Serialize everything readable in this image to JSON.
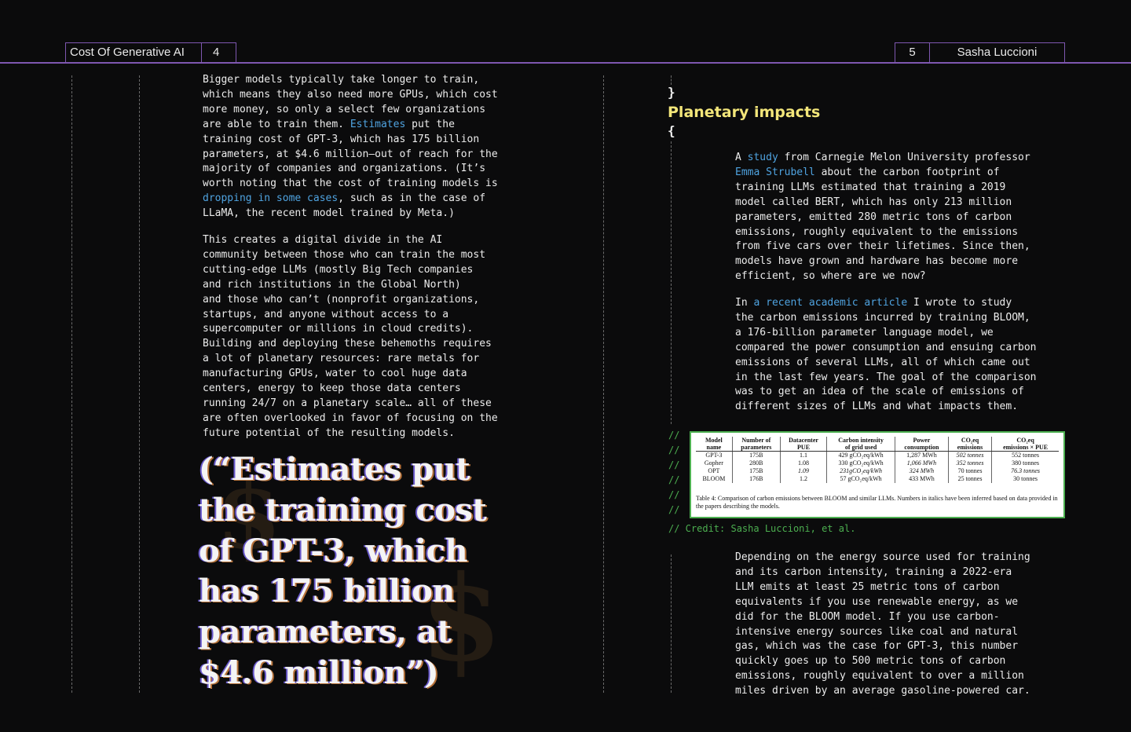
{
  "header": {
    "left_title": "Cost Of Generative AI",
    "left_page": "4",
    "right_page": "5",
    "right_author": "Sasha Luccioni"
  },
  "left": {
    "p1": [
      {
        "t": "Bigger models typically take longer to train,\nwhich means they also need more GPUs, which cost\nmore money, so only a select few organizations\nare able to train them. "
      },
      {
        "t": "Estimates",
        "link": true
      },
      {
        "t": " put the\ntraining cost of GPT-3, which has 175 billion\nparameters, at $4.6 million—out of reach for the\nmajority of companies and organizations. (It’s\nworth noting that the cost of training models is\n"
      },
      {
        "t": "dropping in some cases",
        "link": true
      },
      {
        "t": ", such as in the case of\nLLaMA, the recent model trained by Meta.)"
      }
    ],
    "p2": "This creates a digital divide in the AI\ncommunity between those who can train the most\ncutting-edge LLMs (mostly Big Tech companies\nand rich institutions in the Global North)\nand those who can’t (nonprofit organizations,\nstartups, and anyone without access to a\nsupercomputer or millions in cloud credits).\nBuilding and deploying these behemoths requires\na lot of planetary resources: rare metals for\nmanufacturing GPUs, water to cool huge data\ncenters, energy to keep those data centers\nrunning 24/7 on a planetary scale… all of these\nare often overlooked in favor of focusing on the\nfuture potential of the resulting models.",
    "quote": "(“Estimates put\nthe training cost\nof GPT-3, which\nhas 175 billion\nparameters, at\n$4.6 million”)",
    "bg_glyphs": [
      "$",
      "$"
    ]
  },
  "right": {
    "brace_close": "}",
    "heading": "Planetary impacts",
    "brace_open": "{",
    "p1": [
      {
        "t": "A "
      },
      {
        "t": "study",
        "link": true
      },
      {
        "t": " from Carnegie Melon University professor\n"
      },
      {
        "t": "Emma Strubell",
        "link": true
      },
      {
        "t": " about the carbon footprint of\ntraining LLMs estimated that training a 2019\nmodel called BERT, which has only 213 million\nparameters, emitted 280 metric tons of carbon\nemissions, roughly equivalent to the emissions\nfrom five cars over their lifetimes. Since then,\nmodels have grown and hardware has become more\nefficient, so where are we now?"
      }
    ],
    "p2": [
      {
        "t": "In "
      },
      {
        "t": "a recent academic article",
        "link": true
      },
      {
        "t": " I wrote to study\nthe carbon emissions incurred by training BLOOM,\na 176-billion parameter language model, we\ncompared the power consumption and ensuing carbon\nemissions of several LLMs, all of which came out\nin the last few years. The goal of the comparison\nwas to get an idea of the scale of emissions of\ndifferent sizes of LLMs and what impacts them."
      }
    ],
    "comment_marker": "//",
    "table": {
      "headers": [
        "Model\nname",
        "Number of\nparameters",
        "Datacenter\nPUE",
        "Carbon intensity\nof grid used",
        "Power\nconsumption",
        "CO₂eq\nemissions",
        "CO₂eq\nemissions × PUE"
      ],
      "rows": [
        [
          "GPT-3",
          "175B",
          "1.1",
          "429 gCO₂eq/kWh",
          "1,287 MWh",
          "502 tonnes",
          "552 tonnes"
        ],
        [
          "Gopher",
          "280B",
          "1.08",
          "330 gCO₂eq/kWh",
          "1,066 MWh",
          "352 tonnes",
          "380 tonnes"
        ],
        [
          "OPT",
          "175B",
          "1.09",
          "231gCO₂eq/kWh",
          "324 MWh",
          "70 tonnes",
          "76.3 tonnes"
        ],
        [
          "BLOOM",
          "176B",
          "1.2",
          "57 gCO₂eq/kWh",
          "433 MWh",
          "25 tonnes",
          "30 tonnes"
        ]
      ],
      "caption": "Table 4: Comparison of carbon emissions between BLOOM and similar LLMs. Numbers in italics have been inferred based on data provided in the papers describing the models."
    },
    "credit": "// Credit: Sasha Luccioni, et al.",
    "p3": "Depending on the energy source used for training\nand its carbon intensity, training a 2022-era\nLLM emits at least 25 metric tons of carbon\nequivalents if you use renewable energy, as we\ndid for the BLOOM model. If you use carbon-\nintensive energy sources like coal and natural\ngas, which was the case for GPT-3, this number\nquickly goes up to 500 metric tons of carbon\nemissions, roughly equivalent to over a million\nmiles driven by an average gasoline-powered car."
  }
}
